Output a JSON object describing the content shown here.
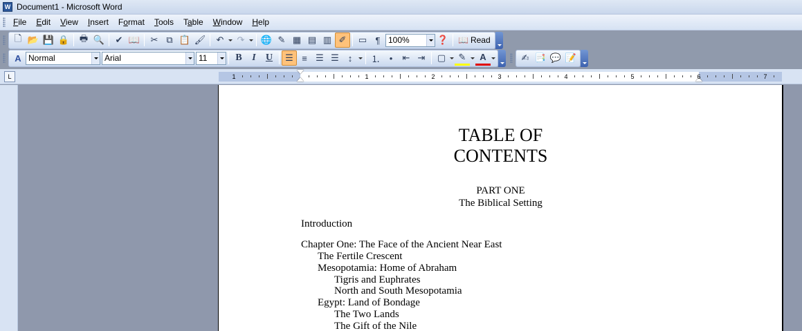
{
  "window": {
    "title": "Document1 - Microsoft Word",
    "icon": "word-app-icon"
  },
  "menu": [
    "File",
    "Edit",
    "View",
    "Insert",
    "Format",
    "Tools",
    "Table",
    "Window",
    "Help"
  ],
  "menu_accel": [
    "F",
    "E",
    "V",
    "I",
    "o",
    "T",
    "a",
    "W",
    "H"
  ],
  "standard_toolbar": {
    "zoom": "100%",
    "read_label": "Read",
    "paragraph_mark": "¶"
  },
  "format_toolbar": {
    "style": "Normal",
    "font": "Arial",
    "size": "11",
    "bold": "B",
    "italic": "I",
    "underline": "U"
  },
  "ruler": {
    "numbers": [
      "1",
      "1",
      "2",
      "3",
      "4",
      "5",
      "6",
      "7"
    ]
  },
  "document": {
    "title_line1": "TABLE OF",
    "title_line2": "CONTENTS",
    "part_line1": "PART ONE",
    "part_line2": "The Biblical Setting",
    "entries": [
      "Introduction",
      "Chapter One: The Face of the Ancient Near East",
      "The Fertile Crescent",
      "Mesopotamia: Home of Abraham",
      "Tigris and Euphrates",
      "North and South Mesopotamia",
      "Egypt: Land of Bondage",
      "The Two Lands",
      "The Gift of the Nile"
    ]
  }
}
